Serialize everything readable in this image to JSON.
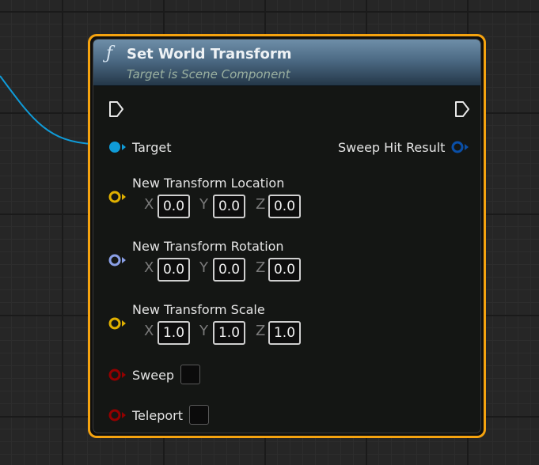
{
  "node": {
    "function_icon": "ƒ",
    "title": "Set World Transform",
    "subtitle": "Target is Scene Component",
    "border_color": "#f5a30f"
  },
  "pins": {
    "target": {
      "label": "Target",
      "color": "#0f9bd8",
      "icon": "object-pin-icon"
    },
    "sweep_hit_result": {
      "label": "Sweep Hit Result",
      "color": "#0a4fa8",
      "icon": "struct-pin-icon"
    },
    "location": {
      "label": "New Transform Location",
      "color": "#e0b000",
      "icon": "vector-pin-icon",
      "x_label": "X",
      "y_label": "Y",
      "z_label": "Z",
      "x": "0.0",
      "y": "0.0",
      "z": "0.0"
    },
    "rotation": {
      "label": "New Transform Rotation",
      "color": "#8a9fe6",
      "icon": "rotator-pin-icon",
      "x_label": "X",
      "y_label": "Y",
      "z_label": "Z",
      "x": "0.0",
      "y": "0.0",
      "z": "0.0"
    },
    "scale": {
      "label": "New Transform Scale",
      "color": "#e0b000",
      "icon": "vector-pin-icon",
      "x_label": "X",
      "y_label": "Y",
      "z_label": "Z",
      "x": "1.0",
      "y": "1.0",
      "z": "1.0"
    },
    "sweep": {
      "label": "Sweep",
      "color": "#940000",
      "icon": "bool-pin-icon",
      "checked": false
    },
    "teleport": {
      "label": "Teleport",
      "color": "#940000",
      "icon": "bool-pin-icon",
      "checked": false
    }
  },
  "wire_color": "#0f9bd8"
}
